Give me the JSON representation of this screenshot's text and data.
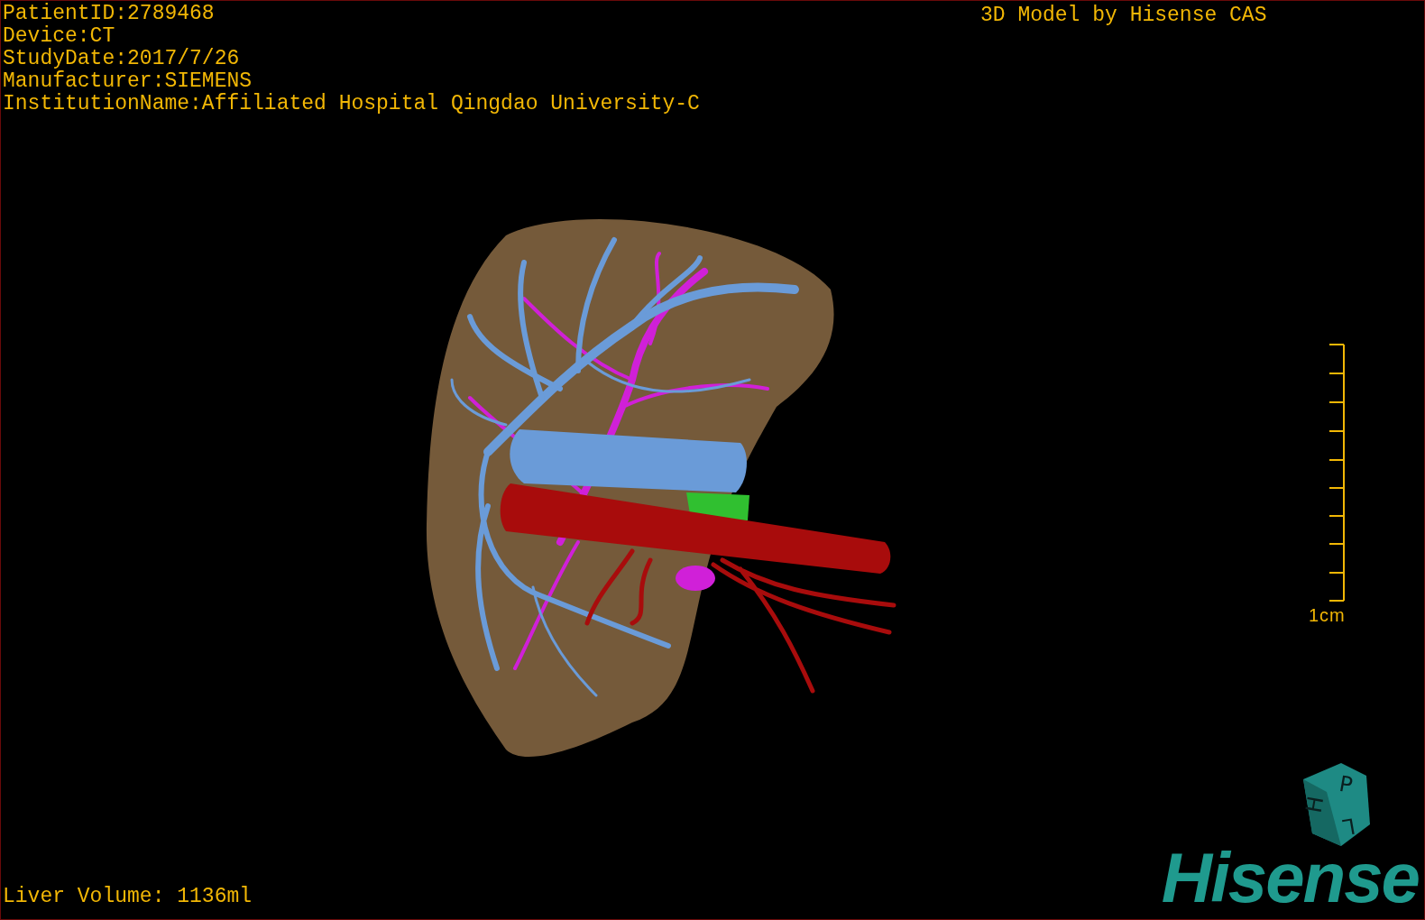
{
  "patient_info": [
    "PatientID:2789468",
    "Device:CT",
    "StudyDate:2017/7/26",
    "Manufacturer:SIEMENS",
    "InstitutionName:Affiliated Hospital Qingdao University-C"
  ],
  "header_right": "3D Model by Hisense CAS",
  "scale_bar": {
    "label": "1cm"
  },
  "orientation_cube": {
    "faces": [
      "P",
      "H",
      "L"
    ]
  },
  "logo": "Hisense",
  "liver_volume": "Liver Volume: 1136ml"
}
